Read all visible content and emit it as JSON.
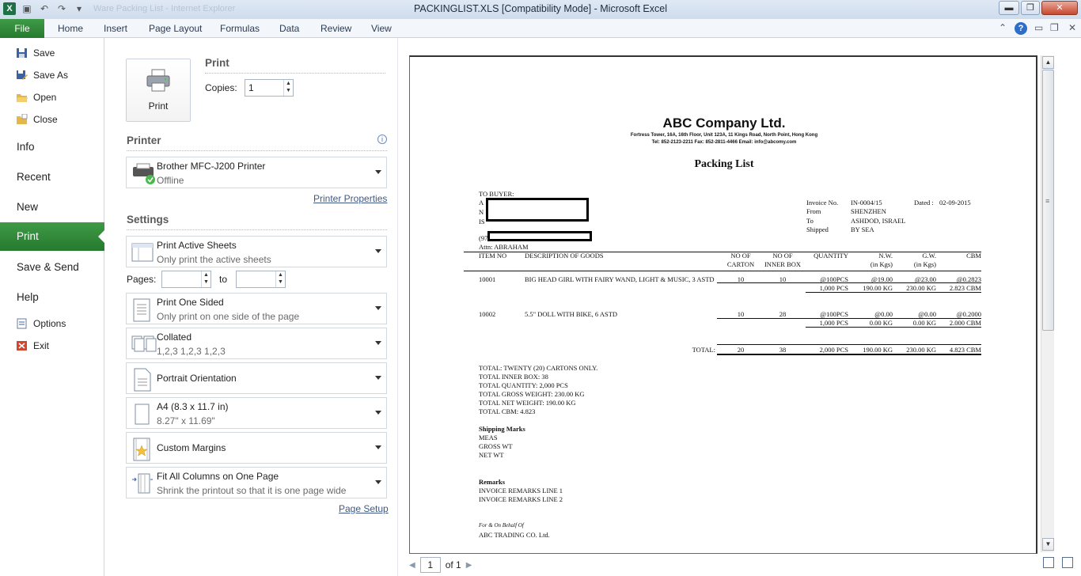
{
  "window": {
    "title": "PACKINGLIST.XLS  [Compatibility Mode]  -  Microsoft Excel",
    "ghost_title": "Ware Packing List - Internet Explorer",
    "min": "▬",
    "max": "❐",
    "close": "✕"
  },
  "ribbon": {
    "file": "File",
    "tabs": [
      "Home",
      "Insert",
      "Page Layout",
      "Formulas",
      "Data",
      "Review",
      "View"
    ]
  },
  "sidebar": {
    "save": "Save",
    "save_as": "Save As",
    "open": "Open",
    "close": "Close",
    "info": "Info",
    "recent": "Recent",
    "new": "New",
    "print": "Print",
    "save_send": "Save & Send",
    "help": "Help",
    "options": "Options",
    "exit": "Exit"
  },
  "print_panel": {
    "heading": "Print",
    "button": "Print",
    "copies_label": "Copies:",
    "copies_value": "1",
    "printer_heading": "Printer",
    "printer_name": "Brother MFC-J200 Printer",
    "printer_status": "Offline",
    "printer_properties": "Printer Properties",
    "settings_heading": "Settings",
    "sheets_t1": "Print Active Sheets",
    "sheets_t2": "Only print the active sheets",
    "pages_label": "Pages:",
    "pages_to": "to",
    "sided_t1": "Print One Sided",
    "sided_t2": "Only print on one side of the page",
    "collated_t1": "Collated",
    "collated_t2": "1,2,3    1,2,3    1,2,3",
    "orientation": "Portrait Orientation",
    "paper_t1": "A4 (8.3 x 11.7 in)",
    "paper_t2": "8.27\" x 11.69\"",
    "margins": "Custom Margins",
    "scaling_t1": "Fit All Columns on One Page",
    "scaling_t2": "Shrink the printout so that it is one page wide",
    "page_setup": "Page Setup"
  },
  "document": {
    "company": "ABC Company Ltd.",
    "address": "Fortress Tower, 16A, 16th Floor, Unit 123A, 11 Kings Road, North Point, Hong Kong",
    "contact": "Tel: 852-2123-2211   Fax: 852-2811-4466   Email: info@abcomy.com",
    "doc_title": "Packing List",
    "to_buyer": "TO BUYER:",
    "frag_a": "A",
    "frag_n": "N",
    "frag_is": "IS",
    "frag_97": "(97",
    "attn": "Attn: ABRAHAM",
    "invoice_label": "Invoice No.",
    "invoice_value": "IN-0004/15",
    "dated_label": "Dated :",
    "dated_value": "02-09-2015",
    "from_label": "From",
    "from_value": "SHENZHEN",
    "to_label": "To",
    "to_value": "ASHDOD, ISRAEL",
    "shipped_label": "Shipped",
    "shipped_value": "BY SEA",
    "headers": {
      "item": "ITEM NO",
      "desc": "DESCRIPTION OF GOODS",
      "carton1": "NO OF",
      "carton2": "CARTON",
      "inner1": "NO OF",
      "inner2": "INNER BOX",
      "qty": "QUANTITY",
      "nw1": "N.W.",
      "nw2": "(in Kgs)",
      "gw1": "G.W.",
      "gw2": "(in Kgs)",
      "cbm": "CBM"
    },
    "rows": [
      {
        "item": "10001",
        "desc": "BIG HEAD GIRL WITH FAIRY WAND, LIGHT & MUSIC, 3 ASTD",
        "carton": "10",
        "inner": "10",
        "qty": "@100PCS",
        "nw": "@19.00",
        "gw": "@23.00",
        "cbm": "@0.2823",
        "qty_t": "1,000 PCS",
        "nw_t": "190.00 KG",
        "gw_t": "230.00 KG",
        "cbm_t": "2.823 CBM"
      },
      {
        "item": "10002",
        "desc": "5.5\" DOLL WITH BIKE, 6 ASTD",
        "carton": "10",
        "inner": "28",
        "qty": "@100PCS",
        "nw": "@0.00",
        "gw": "@0.00",
        "cbm": "@0.2000",
        "qty_t": "1,000 PCS",
        "nw_t": "0.00 KG",
        "gw_t": "0.00 KG",
        "cbm_t": "2.000 CBM"
      }
    ],
    "total": {
      "label": "TOTAL:",
      "carton": "20",
      "inner": "38",
      "qty": "2,000 PCS",
      "nw": "190.00 KG",
      "gw": "230.00 KG",
      "cbm": "4.823 CBM"
    },
    "summary": [
      "TOTAL: TWENTY  (20) CARTONS ONLY.",
      "TOTAL INNER BOX: 38",
      "TOTAL QUANTITY: 2,000 PCS",
      "TOTAL GROSS WEIGHT: 230.00 KG",
      "TOTAL NET WEIGHT: 190.00 KG",
      "TOTAL CBM: 4.823"
    ],
    "marks_title": "Shipping Marks",
    "marks": [
      "MEAS",
      "GROSS WT",
      "NET WT"
    ],
    "remarks_title": "Remarks",
    "remarks": [
      "INVOICE REMARKS LINE 1",
      "INVOICE REMARKS LINE 2"
    ],
    "behalf": "For & On Behalf Of",
    "trading": "ABC TRADING CO. Ltd."
  },
  "pager": {
    "current": "1",
    "of": "of 1"
  }
}
